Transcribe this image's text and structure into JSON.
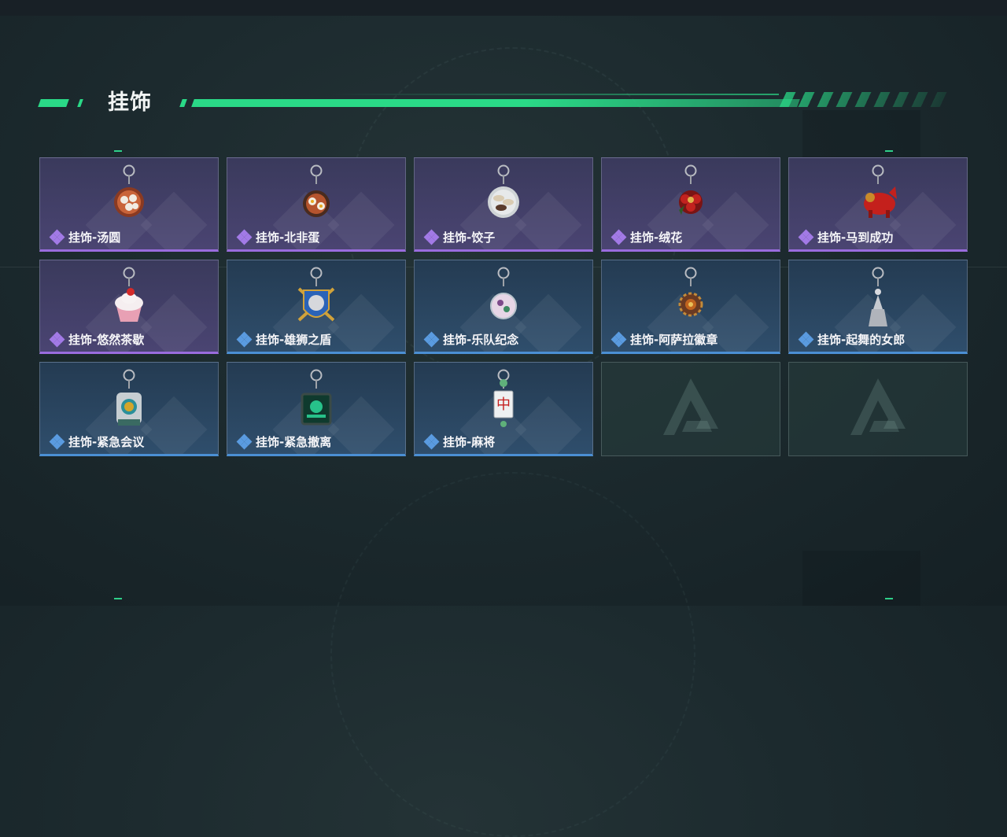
{
  "section": {
    "title": "挂饰"
  },
  "colors": {
    "accent": "#2ad987",
    "purple_rarity": "#9a6cde",
    "blue_rarity": "#4b8fd4"
  },
  "items": [
    {
      "label": "挂饰-汤圆",
      "rarity": "purple",
      "icon": "tangyuan-charm-icon"
    },
    {
      "label": "挂饰-北非蛋",
      "rarity": "purple",
      "icon": "shakshuka-charm-icon"
    },
    {
      "label": "挂饰-饺子",
      "rarity": "purple",
      "icon": "dumpling-charm-icon"
    },
    {
      "label": "挂饰-绒花",
      "rarity": "purple",
      "icon": "velvet-flower-charm-icon"
    },
    {
      "label": "挂饰-马到成功",
      "rarity": "purple",
      "icon": "horse-charm-icon"
    },
    {
      "label": "挂饰-悠然茶歇",
      "rarity": "purple",
      "icon": "cupcake-charm-icon"
    },
    {
      "label": "挂饰-雄狮之盾",
      "rarity": "blue",
      "icon": "lion-shield-charm-icon"
    },
    {
      "label": "挂饰-乐队纪念",
      "rarity": "blue",
      "icon": "band-badge-charm-icon"
    },
    {
      "label": "挂饰-阿萨拉徽章",
      "rarity": "blue",
      "icon": "asala-emblem-charm-icon"
    },
    {
      "label": "挂饰-起舞的女郎",
      "rarity": "blue",
      "icon": "dancer-charm-icon"
    },
    {
      "label": "挂饰-紧急会议",
      "rarity": "blue",
      "icon": "emergency-meeting-charm-icon"
    },
    {
      "label": "挂饰-紧急撤离",
      "rarity": "blue",
      "icon": "evacuation-charm-icon"
    },
    {
      "label": "挂饰-麻将",
      "rarity": "blue",
      "icon": "mahjong-charm-icon"
    },
    {
      "label": "",
      "rarity": "empty",
      "icon": "game-logo-icon"
    },
    {
      "label": "",
      "rarity": "empty",
      "icon": "game-logo-icon"
    }
  ]
}
